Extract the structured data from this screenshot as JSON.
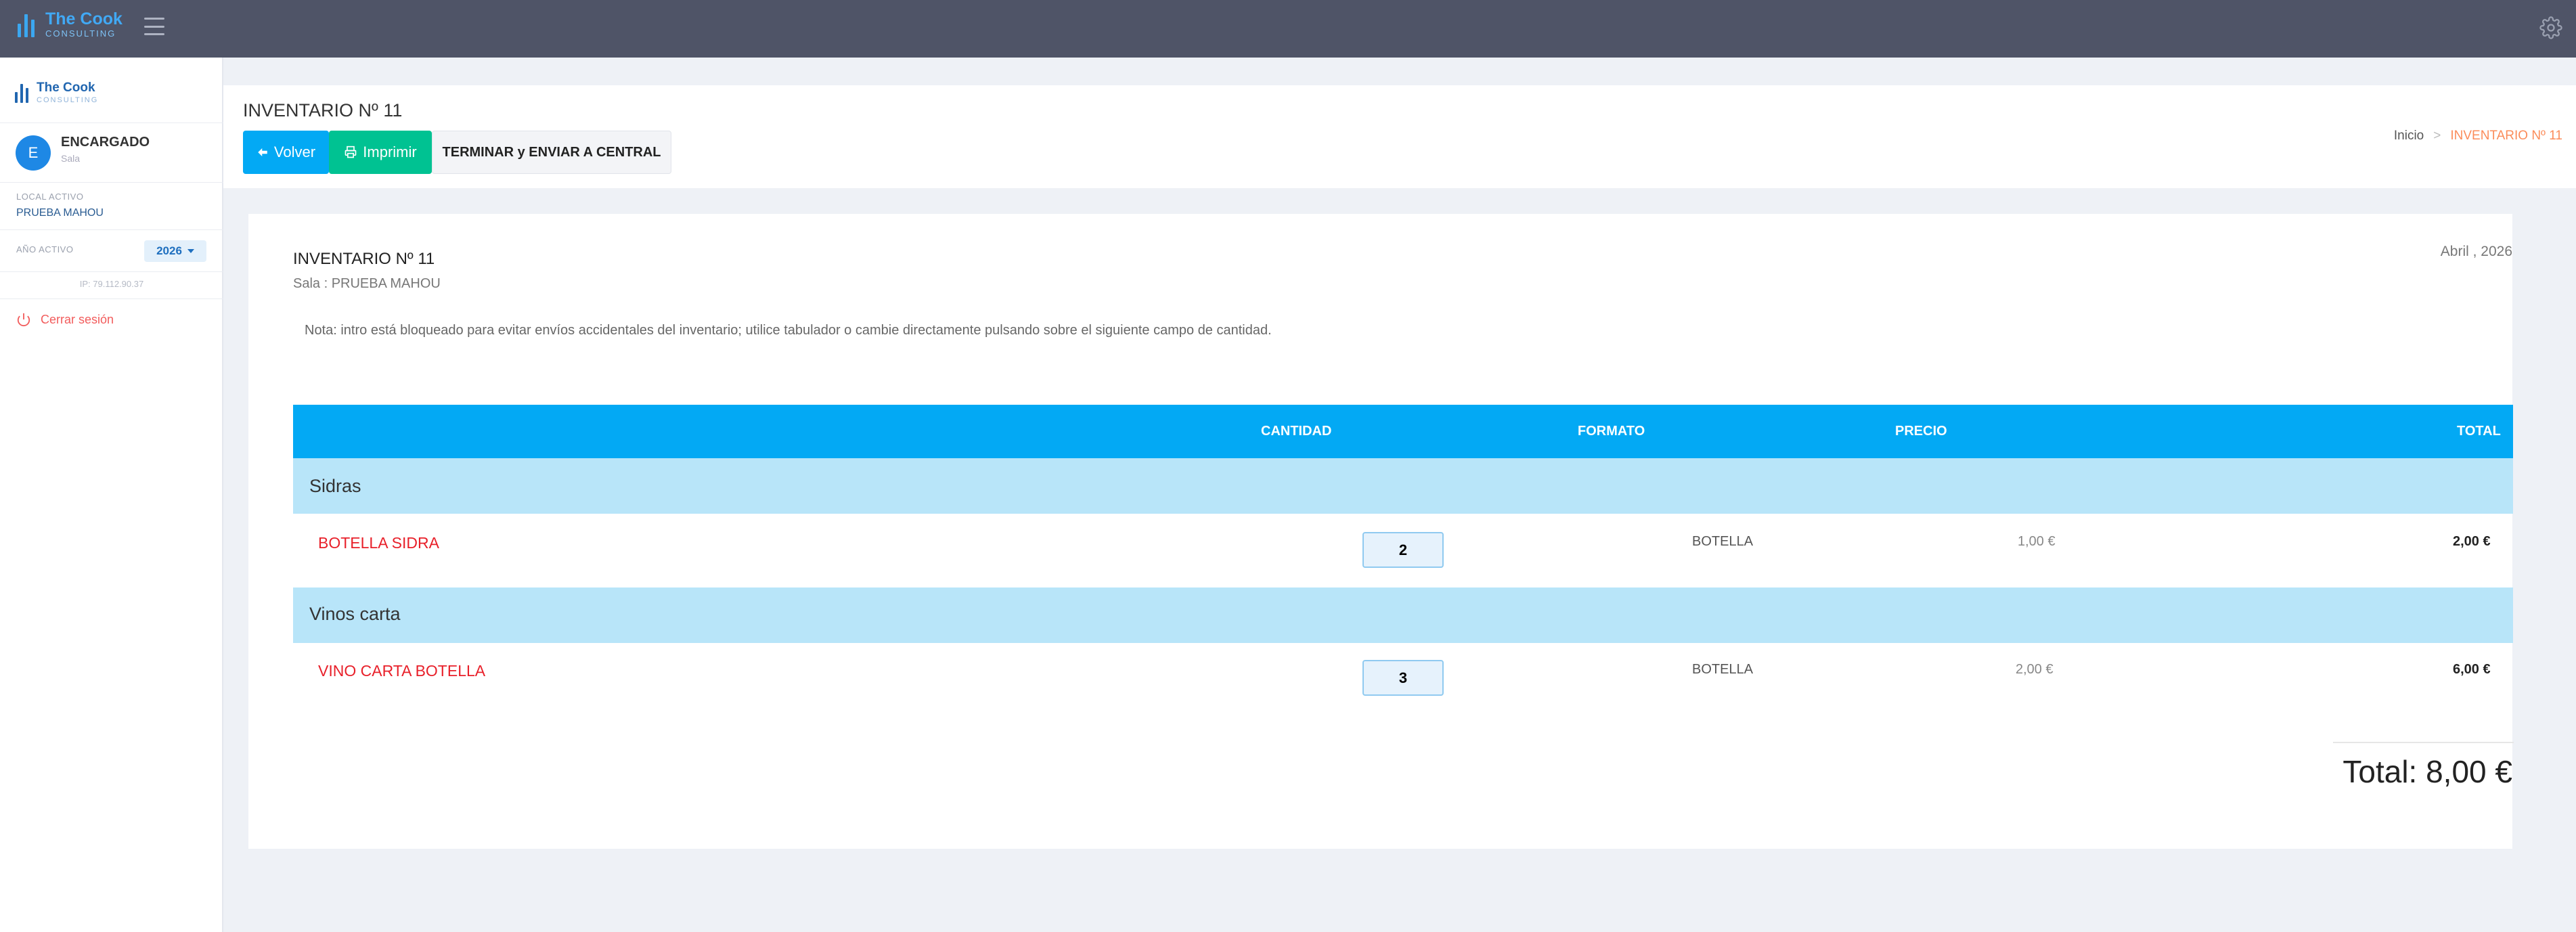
{
  "app": {
    "brand_name": "The Cook",
    "brand_sub": "CONSULTING"
  },
  "sidebar": {
    "user_initial": "E",
    "user_name": "ENCARGADO",
    "user_role": "Sala",
    "local_label": "LOCAL ACTIVO",
    "local_value": "PRUEBA MAHOU",
    "year_label": "AÑO ACTIVO",
    "year_value": "2026",
    "ip": "IP: 79.112.90.37",
    "logout_label": "Cerrar sesión"
  },
  "header": {
    "title": "INVENTARIO Nº 11",
    "volver_label": "Volver",
    "imprimir_label": "Imprimir",
    "terminar_label": "TERMINAR y ENVIAR A CENTRAL",
    "breadcrumb_home": "Inicio",
    "breadcrumb_sep": ">",
    "breadcrumb_current": "INVENTARIO Nº 11"
  },
  "inventory": {
    "title": "INVENTARIO Nº 11",
    "sala": "Sala : PRUEBA MAHOU",
    "date": "Abril , 2026",
    "note": "Nota: intro está bloqueado para evitar envíos accidentales del inventario; utilice tabulador o cambie directamente pulsando sobre el siguiente campo de cantidad.",
    "columns": {
      "cantidad": "CANTIDAD",
      "formato": "FORMATO",
      "precio": "PRECIO",
      "total": "TOTAL"
    },
    "categories": [
      {
        "name": "Sidras",
        "items": [
          {
            "name": "BOTELLA SIDRA",
            "qty": "2",
            "format": "BOTELLA",
            "price": "1,00 €",
            "total": "2,00 €"
          }
        ]
      },
      {
        "name": "Vinos carta",
        "items": [
          {
            "name": "VINO CARTA BOTELLA",
            "qty": "3",
            "format": "BOTELLA",
            "price": "2,00 €",
            "total": "6,00 €"
          }
        ]
      }
    ],
    "grand_total": "Total: 8,00 €"
  },
  "colors": {
    "topbar": "#4f5467",
    "primary": "#03a9f4",
    "success": "#00c292",
    "danger": "#e8202a",
    "category_bg": "#b8e5f9"
  }
}
